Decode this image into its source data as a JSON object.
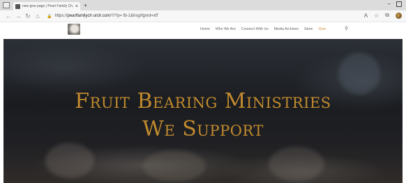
{
  "browser": {
    "tab_title": "new give page | Pearl Family Ch...",
    "url_prefix": "https://",
    "url_host": "pearlfamilych urch.com",
    "url_path": "/?/?p= fb-1&hsgrfgnrd=xff"
  },
  "site": {
    "nav": [
      "Home",
      "Who We Are",
      "Connect With Us",
      "Media Archives",
      "Store",
      "Give"
    ],
    "accent_color": "#c8933a"
  },
  "hero": {
    "line1": "Fruit Bearing Ministries",
    "line2": "We Support",
    "title_color": "#c18a2e"
  }
}
